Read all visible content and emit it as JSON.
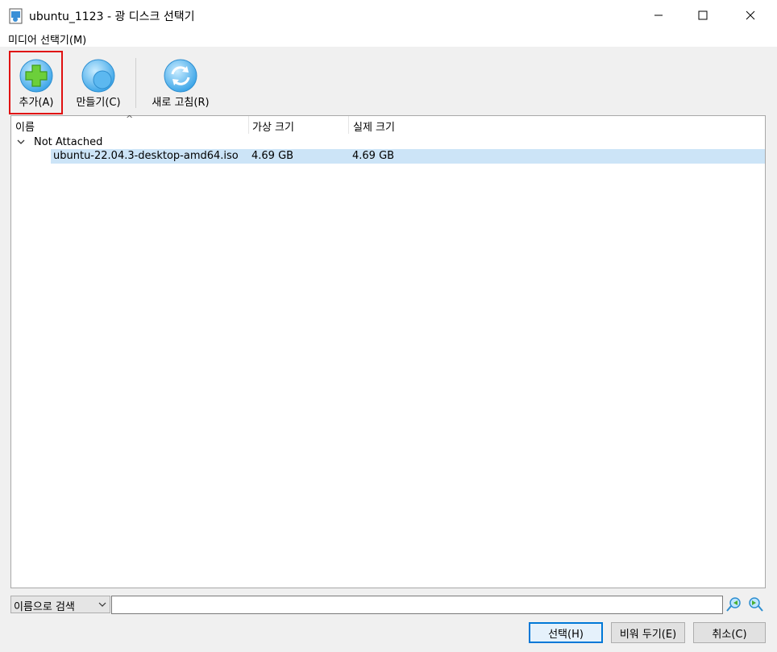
{
  "window": {
    "title": "ubuntu_1123 - 광 디스크 선택기",
    "minimize_icon": "minimize-icon",
    "maximize_icon": "maximize-icon",
    "close_icon": "close-icon"
  },
  "menubar": {
    "items": [
      "미디어 선택기(M)"
    ]
  },
  "toolbar": {
    "add_label": "추가(A)",
    "create_label": "만들기(C)",
    "refresh_label": "새로 고침(R)"
  },
  "table": {
    "columns": [
      "이름",
      "가상 크기",
      "실제 크기"
    ],
    "groups": [
      {
        "label": "Not Attached",
        "items": [
          {
            "name": "ubuntu-22.04.3-desktop-amd64.iso",
            "virtual_size": "4.69 GB",
            "actual_size": "4.69 GB",
            "selected": true
          }
        ]
      }
    ]
  },
  "search": {
    "mode": "이름으로 검색",
    "value": ""
  },
  "buttons": {
    "choose": "선택(H)",
    "leave_empty": "비워 두기(E)",
    "cancel": "취소(C)"
  },
  "colors": {
    "selection": "#cce4f7",
    "highlight_border": "#e01010",
    "default_button_border": "#0078d7"
  }
}
